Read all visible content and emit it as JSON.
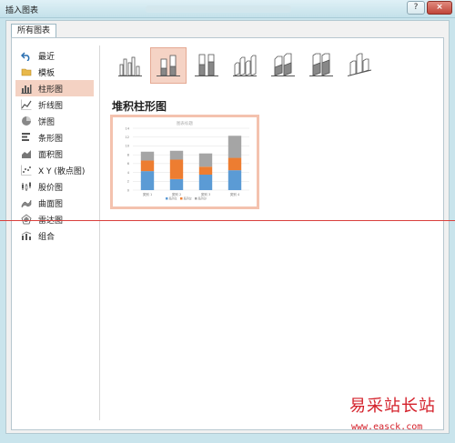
{
  "window": {
    "title": "插入图表"
  },
  "tabs": [
    {
      "label": "所有图表"
    }
  ],
  "sidebar": {
    "items": [
      {
        "label": "最近",
        "icon": "undo-icon"
      },
      {
        "label": "模板",
        "icon": "folder-icon"
      },
      {
        "label": "柱形图",
        "icon": "column-chart-icon",
        "selected": true
      },
      {
        "label": "折线图",
        "icon": "line-chart-icon"
      },
      {
        "label": "饼图",
        "icon": "pie-chart-icon"
      },
      {
        "label": "条形图",
        "icon": "bar-chart-icon"
      },
      {
        "label": "面积图",
        "icon": "area-chart-icon"
      },
      {
        "label": "X Y (散点图)",
        "icon": "scatter-chart-icon"
      },
      {
        "label": "股价图",
        "icon": "stock-chart-icon"
      },
      {
        "label": "曲面图",
        "icon": "surface-chart-icon"
      },
      {
        "label": "雷达图",
        "icon": "radar-chart-icon"
      },
      {
        "label": "组合",
        "icon": "combo-chart-icon"
      }
    ]
  },
  "subtypes": [
    {
      "name": "clustered-column-icon"
    },
    {
      "name": "stacked-column-icon",
      "selected": true
    },
    {
      "name": "100-stacked-column-icon"
    },
    {
      "name": "3d-clustered-column-icon"
    },
    {
      "name": "3d-stacked-column-icon"
    },
    {
      "name": "3d-100-stacked-column-icon"
    },
    {
      "name": "3d-column-icon"
    }
  ],
  "section": {
    "title": "堆积柱形图"
  },
  "preview": {
    "title": "图表标题",
    "colors": [
      "#5b9bd5",
      "#ed7d31",
      "#a5a5a5"
    ],
    "chart_data": {
      "type": "bar",
      "stacked": true,
      "title": "图表标题",
      "categories": [
        "类别 1",
        "类别 2",
        "类别 3",
        "类别 4"
      ],
      "series": [
        {
          "name": "系列1",
          "values": [
            4.3,
            2.5,
            3.5,
            4.5
          ]
        },
        {
          "name": "系列2",
          "values": [
            2.4,
            4.4,
            1.8,
            2.8
          ]
        },
        {
          "name": "系列3",
          "values": [
            2,
            2,
            3,
            5
          ]
        }
      ],
      "ylim": [
        0,
        14
      ],
      "yticks": [
        0,
        2,
        4,
        6,
        8,
        10,
        12,
        14
      ],
      "grid": true,
      "legend": "bottom"
    }
  },
  "watermark": {
    "line1": "易采站长站",
    "line2": "www.easck.com"
  }
}
